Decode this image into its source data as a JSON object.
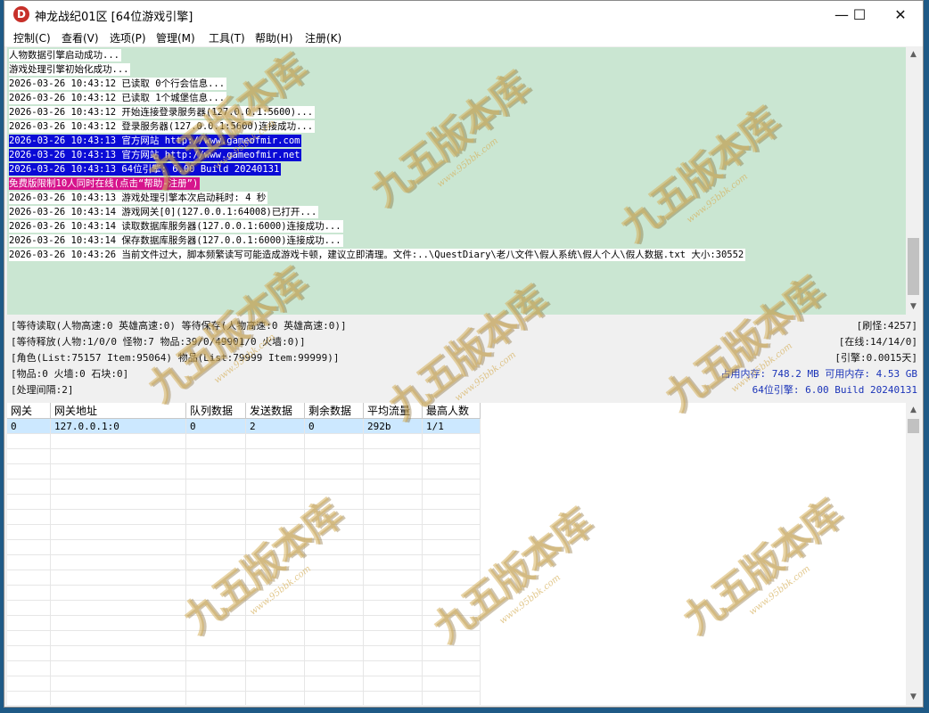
{
  "window": {
    "title": "神龙战纪01区 [64位游戏引擎]",
    "icon_letter": "D"
  },
  "window_controls": {
    "minimize": "—",
    "maximize": "☐",
    "close": "✕"
  },
  "menu": [
    "控制(C)",
    "查看(V)",
    "选项(P)",
    "管理(M)",
    "工具(T)",
    "帮助(H)",
    "注册(K)"
  ],
  "log": [
    {
      "text": "人物数据引擎启动成功...",
      "style": "normal"
    },
    {
      "text": "游戏处理引擎初始化成功...",
      "style": "normal"
    },
    {
      "text": "2026-03-26 10:43:12 已读取 0个行会信息...",
      "style": "normal"
    },
    {
      "text": "2026-03-26 10:43:12 已读取 1个城堡信息...",
      "style": "normal"
    },
    {
      "text": "2026-03-26 10:43:12 开始连接登录服务器(127.0.0.1:5600)...",
      "style": "normal"
    },
    {
      "text": "2026-03-26 10:43:12 登录服务器(127.0.0.1:5600)连接成功...",
      "style": "normal"
    },
    {
      "text": "2026-03-26 10:43:13 官方网站 http://www.gameofmir.com",
      "style": "sel"
    },
    {
      "text": "2026-03-26 10:43:13 官方网站 http://www.gameofmir.net",
      "style": "sel"
    },
    {
      "text": "2026-03-26 10:43:13 64位引擎: 6.00 Build 20240131",
      "style": "sel"
    },
    {
      "text": "免费版限制10人同时在线(点击“帮助-注册”)",
      "style": "warn"
    },
    {
      "text": "2026-03-26 10:43:13 游戏处理引擎本次启动耗时: 4 秒",
      "style": "normal"
    },
    {
      "text": "2026-03-26 10:43:14 游戏网关[0](127.0.0.1:64008)已打开...",
      "style": "normal"
    },
    {
      "text": "2026-03-26 10:43:14 读取数据库服务器(127.0.0.1:6000)连接成功...",
      "style": "normal"
    },
    {
      "text": "2026-03-26 10:43:14 保存数据库服务器(127.0.0.1:6000)连接成功...",
      "style": "normal"
    },
    {
      "text": "2026-03-26 10:43:26 当前文件过大，脚本频繁读写可能造成游戏卡顿，建议立即清理。文件:..\\QuestDiary\\老八文件\\假人系统\\假人个人\\假人数据.txt 大小:30552",
      "style": "normal"
    }
  ],
  "status": {
    "left": [
      "[等待读取(人物高速:0 英雄高速:0) 等待保存(人物高速:0 英雄高速:0)]",
      "[等待释放(人物:1/0/0 怪物:7 物品:39/0/49901/0 火墙:0)]",
      "[角色(List:75157 Item:95064) 物品(List:79999 Item:99999)]",
      "[物品:0 火墙:0 石块:0]",
      "[处理间隔:2]"
    ],
    "right": [
      "[刷怪:4257]",
      "[在线:14/14/0]",
      "[引擎:0.0015天]",
      "占用内存: 748.2 MB 可用内存: 4.53 GB",
      "64位引擎: 6.00 Build 20240131"
    ]
  },
  "gateway_table": {
    "columns": [
      "网关",
      "网关地址",
      "队列数据",
      "发送数据",
      "剩余数据",
      "平均流量",
      "最高人数"
    ],
    "rows": [
      [
        "0",
        "127.0.0.1:0",
        "0",
        "2",
        "0",
        "292b",
        "1/1"
      ]
    ]
  },
  "watermark": {
    "text": "九五版本库",
    "url": "www.95bbk.com"
  },
  "colors": {
    "log_bg": "#cae6d2",
    "selected_line": "#0a0ad6",
    "warning_line": "#d6148c",
    "accent_blue": "#1a33b8"
  }
}
